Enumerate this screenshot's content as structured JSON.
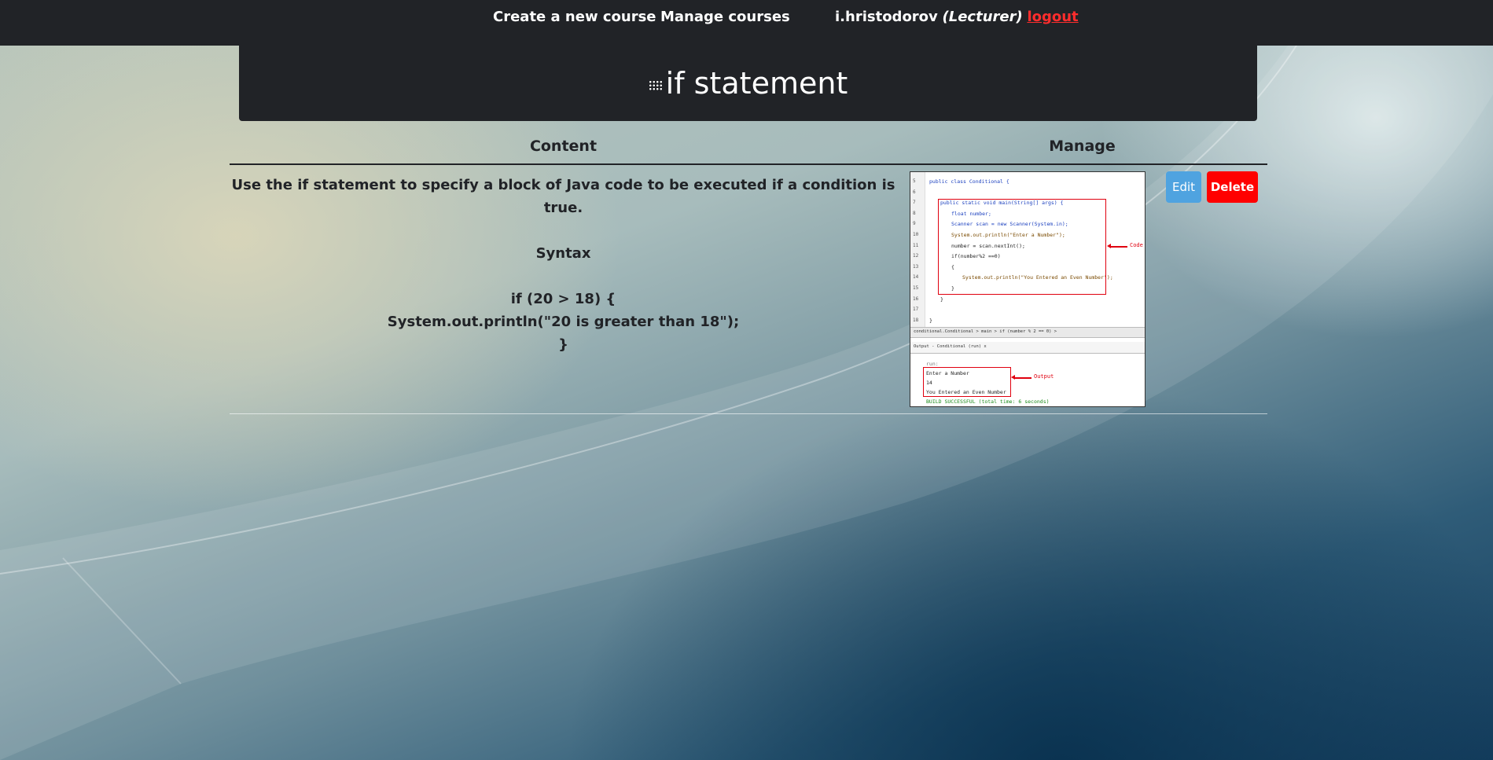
{
  "topbar": {
    "create_course": "Create a new course",
    "manage_courses": "Manage courses",
    "username": "i.hristodorov",
    "role": "(Lecturer)",
    "logout": "logout"
  },
  "page": {
    "title": "if statement",
    "title_icon": "grid-icon"
  },
  "table": {
    "headers": {
      "content": "Content",
      "manage": "Manage"
    },
    "row": {
      "intro": "Use the if statement to specify a block of Java code to be executed if a condition is true.",
      "syntax_heading": "Syntax",
      "code_line_1": "if (20 > 18) {",
      "code_line_2": "System.out.println(\"20 is greater than 18\");",
      "code_line_3": "}",
      "edit_label": "Edit",
      "delete_label": "Delete"
    }
  },
  "screenshot": {
    "code_label": "Code",
    "output_label": "Output",
    "lines": [
      {
        "n": "5",
        "text": "public class Conditional {"
      },
      {
        "n": "6",
        "text": ""
      },
      {
        "n": "7",
        "text": "public static void main(String[] args) {"
      },
      {
        "n": "8",
        "text": "float number;"
      },
      {
        "n": "9",
        "text": "Scanner  scan = new Scanner(System.in);"
      },
      {
        "n": "10",
        "text": "System.out.println(\"Enter a Number\");"
      },
      {
        "n": "11",
        "text": "number = scan.nextInt();"
      },
      {
        "n": "12",
        "text": "if(number%2 ==0)"
      },
      {
        "n": "13",
        "text": "{"
      },
      {
        "n": "14",
        "text": "System.out.println(\"You Entered an Even Number\");"
      },
      {
        "n": "15",
        "text": "}"
      },
      {
        "n": "16",
        "text": "}"
      },
      {
        "n": "17",
        "text": ""
      },
      {
        "n": "18",
        "text": "}"
      }
    ],
    "breadcrumb": "conditional.Conditional  >  main  >  if (number % 2 == 0)  >",
    "output_tab": "Output - Conditional (run)  x",
    "output_run": "run:",
    "output_1": "Enter a Number",
    "output_2": "14",
    "output_3": "You Entered an Even Number",
    "output_build": "BUILD SUCCESSFUL (total time: 6 seconds)"
  },
  "colors": {
    "bar": "#212327",
    "edit": "#4fa3e0",
    "delete": "#ff0000",
    "logout": "#ff2d2d"
  }
}
